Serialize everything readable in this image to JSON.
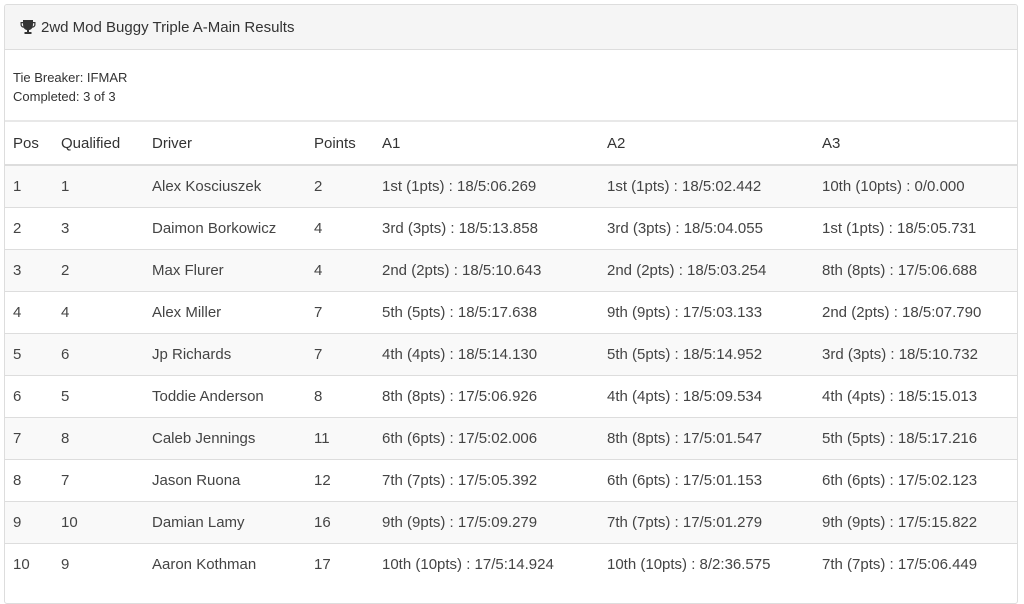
{
  "panel": {
    "title": "2wd Mod Buggy Triple A-Main Results",
    "tie_breaker": "Tie Breaker: IFMAR",
    "completed": "Completed: 3 of 3"
  },
  "table": {
    "headers": [
      "Pos",
      "Qualified",
      "Driver",
      "Points",
      "A1",
      "A2",
      "A3"
    ],
    "rows": [
      [
        "1",
        "1",
        "Alex Kosciuszek",
        "2",
        "1st (1pts) : 18/5:06.269",
        "1st (1pts) : 18/5:02.442",
        "10th (10pts) : 0/0.000"
      ],
      [
        "2",
        "3",
        "Daimon Borkowicz",
        "4",
        "3rd (3pts) : 18/5:13.858",
        "3rd (3pts) : 18/5:04.055",
        "1st (1pts) : 18/5:05.731"
      ],
      [
        "3",
        "2",
        "Max Flurer",
        "4",
        "2nd (2pts) : 18/5:10.643",
        "2nd (2pts) : 18/5:03.254",
        "8th (8pts) : 17/5:06.688"
      ],
      [
        "4",
        "4",
        "Alex Miller",
        "7",
        "5th (5pts) : 18/5:17.638",
        "9th (9pts) : 17/5:03.133",
        "2nd (2pts) : 18/5:07.790"
      ],
      [
        "5",
        "6",
        "Jp Richards",
        "7",
        "4th (4pts) : 18/5:14.130",
        "5th (5pts) : 18/5:14.952",
        "3rd (3pts) : 18/5:10.732"
      ],
      [
        "6",
        "5",
        "Toddie Anderson",
        "8",
        "8th (8pts) : 17/5:06.926",
        "4th (4pts) : 18/5:09.534",
        "4th (4pts) : 18/5:15.013"
      ],
      [
        "7",
        "8",
        "Caleb Jennings",
        "11",
        "6th (6pts) : 17/5:02.006",
        "8th (8pts) : 17/5:01.547",
        "5th (5pts) : 18/5:17.216"
      ],
      [
        "8",
        "7",
        "Jason Ruona",
        "12",
        "7th (7pts) : 17/5:05.392",
        "6th (6pts) : 17/5:01.153",
        "6th (6pts) : 17/5:02.123"
      ],
      [
        "9",
        "10",
        "Damian Lamy",
        "16",
        "9th (9pts) : 17/5:09.279",
        "7th (7pts) : 17/5:01.279",
        "9th (9pts) : 17/5:15.822"
      ],
      [
        "10",
        "9",
        "Aaron Kothman",
        "17",
        "10th (10pts) : 17/5:14.924",
        "10th (10pts) : 8/2:36.575",
        "7th (7pts) : 17/5:06.449"
      ]
    ]
  },
  "icons": {
    "title_icon": "trophy-icon"
  }
}
